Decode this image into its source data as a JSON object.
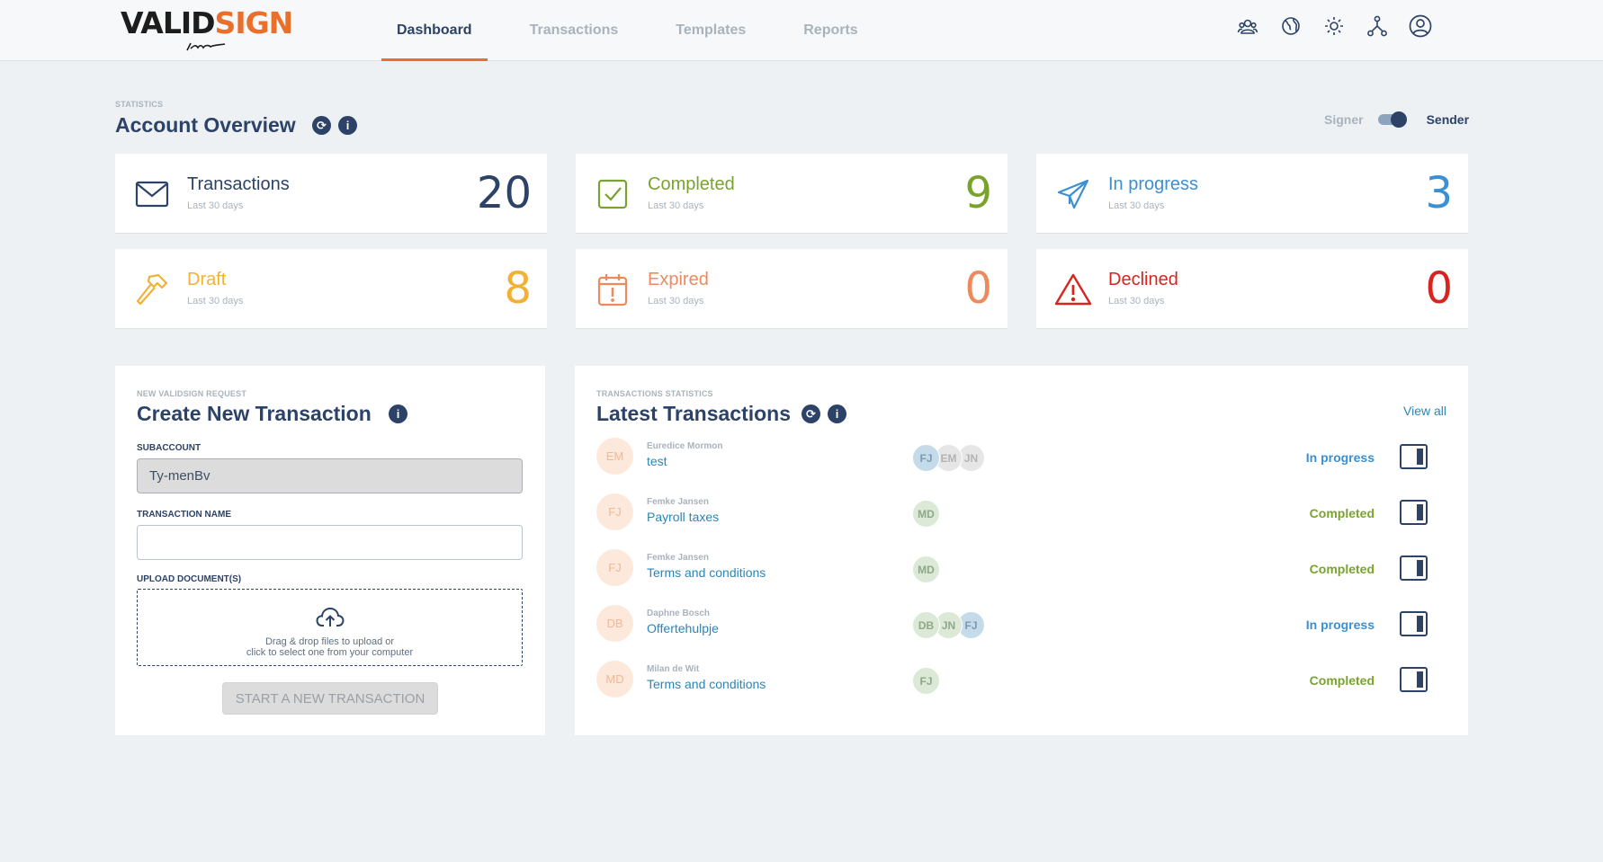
{
  "logo": {
    "part1": "VALID",
    "part2": "SIGN"
  },
  "nav": {
    "tabs": [
      {
        "label": "Dashboard",
        "active": true
      },
      {
        "label": "Transactions",
        "active": false
      },
      {
        "label": "Templates",
        "active": false
      },
      {
        "label": "Reports",
        "active": false
      }
    ]
  },
  "header_icons": [
    "users-icon",
    "globe-icon",
    "sun-icon",
    "network-icon",
    "account-icon"
  ],
  "overview": {
    "label": "STATISTICS",
    "title": "Account Overview",
    "toggle": {
      "left": "Signer",
      "right": "Sender",
      "selected": "Sender"
    },
    "cards": [
      {
        "title": "Transactions",
        "sub": "Last 30 days",
        "count": "20",
        "color": "#2c4266",
        "icon": "envelope-icon"
      },
      {
        "title": "Completed",
        "sub": "Last 30 days",
        "count": "9",
        "color": "#7aa32e",
        "icon": "check-icon"
      },
      {
        "title": "In progress",
        "sub": "Last 30 days",
        "count": "3",
        "color": "#3c8fd0",
        "icon": "paper-plane-icon"
      },
      {
        "title": "Draft",
        "sub": "Last 30 days",
        "count": "8",
        "color": "#f2b134",
        "icon": "hammer-icon"
      },
      {
        "title": "Expired",
        "sub": "Last 30 days",
        "count": "0",
        "color": "#ec8a5e",
        "icon": "calendar-alert-icon"
      },
      {
        "title": "Declined",
        "sub": "Last 30 days",
        "count": "0",
        "color": "#d7241f",
        "icon": "warning-icon"
      }
    ]
  },
  "create": {
    "label": "NEW VALIDSIGN REQUEST",
    "title": "Create New Transaction",
    "subaccount_label": "SUBACCOUNT",
    "subaccount_value": "Ty-menBv",
    "name_label": "TRANSACTION NAME",
    "name_value": "",
    "upload_label": "UPLOAD DOCUMENT(S)",
    "upload_line1": "Drag & drop files to upload or",
    "upload_line2": "click to select one from your computer",
    "button": "START A NEW TRANSACTION"
  },
  "latest": {
    "label": "TRANSACTIONS STATISTICS",
    "title": "Latest Transactions",
    "view_all": "View all",
    "rows": [
      {
        "initials": "EM",
        "sender": "Euredice Mormon",
        "name": "test",
        "signers": [
          {
            "i": "FJ",
            "c": "blue"
          },
          {
            "i": "EM",
            "c": "grey"
          },
          {
            "i": "JN",
            "c": "grey"
          }
        ],
        "status": "In progress",
        "kind": "progress"
      },
      {
        "initials": "FJ",
        "sender": "Femke Jansen",
        "name": "Payroll taxes",
        "signers": [
          {
            "i": "MD",
            "c": "green"
          }
        ],
        "status": "Completed",
        "kind": "done"
      },
      {
        "initials": "FJ",
        "sender": "Femke Jansen",
        "name": "Terms and conditions",
        "signers": [
          {
            "i": "MD",
            "c": "green"
          }
        ],
        "status": "Completed",
        "kind": "done"
      },
      {
        "initials": "DB",
        "sender": "Daphne Bosch",
        "name": "Offertehulpje",
        "signers": [
          {
            "i": "DB",
            "c": "green"
          },
          {
            "i": "JN",
            "c": "green"
          },
          {
            "i": "FJ",
            "c": "blue"
          }
        ],
        "status": "In progress",
        "kind": "progress"
      },
      {
        "initials": "MD",
        "sender": "Milan de Wit",
        "name": "Terms and conditions",
        "signers": [
          {
            "i": "FJ",
            "c": "green"
          }
        ],
        "status": "Completed",
        "kind": "done"
      }
    ]
  }
}
